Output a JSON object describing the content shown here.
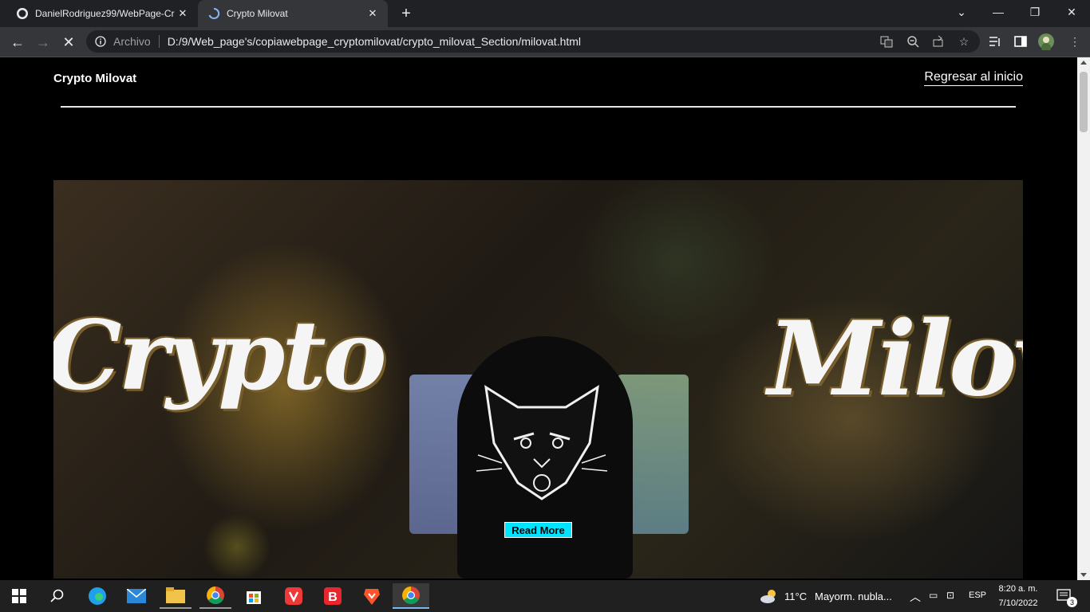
{
  "browser": {
    "tabs": [
      {
        "title": "DanielRodriguez99/WebPage-Cr",
        "favicon": "github-icon",
        "state": "inactive"
      },
      {
        "title": "Crypto Milovat",
        "favicon": "loading-spinner-icon",
        "state": "active"
      }
    ],
    "new_tab": "+",
    "window_controls": {
      "minimize": "—",
      "restore": "❐",
      "close": "✕"
    },
    "address": {
      "scheme_label": "Archivo",
      "url": "D:/9/Web_page's/copiawebpage_cryptomilovat/crypto_milovat_Section/milovat.html"
    },
    "toolbar_icons": [
      "translate-icon",
      "zoom-out-icon",
      "share-icon",
      "bookmark-star-icon",
      "media-controls-icon",
      "side-panel-icon",
      "profile-avatar-icon",
      "more-menu-icon"
    ]
  },
  "page": {
    "brand": "Crypto Milovat",
    "back_link": "Regresar al inicio",
    "hero": {
      "left_script": "Crypto",
      "right_script": "Milov",
      "button": "Read More",
      "button_color": "#00e5ff"
    }
  },
  "taskbar": {
    "apps": [
      "windows-start-icon",
      "search-icon",
      "edge-icon",
      "mail-icon",
      "file-explorer-icon",
      "chrome-icon",
      "microsoft-store-icon",
      "vivaldi-icon",
      "brave-b-icon",
      "brave-lion-icon",
      "chrome-active-icon"
    ],
    "weather": {
      "temp": "11°C",
      "desc": "Mayorm. nubla..."
    },
    "language": "ESP",
    "time": "8:20 a. m.",
    "date": "7/10/2022",
    "notifications": "3"
  }
}
